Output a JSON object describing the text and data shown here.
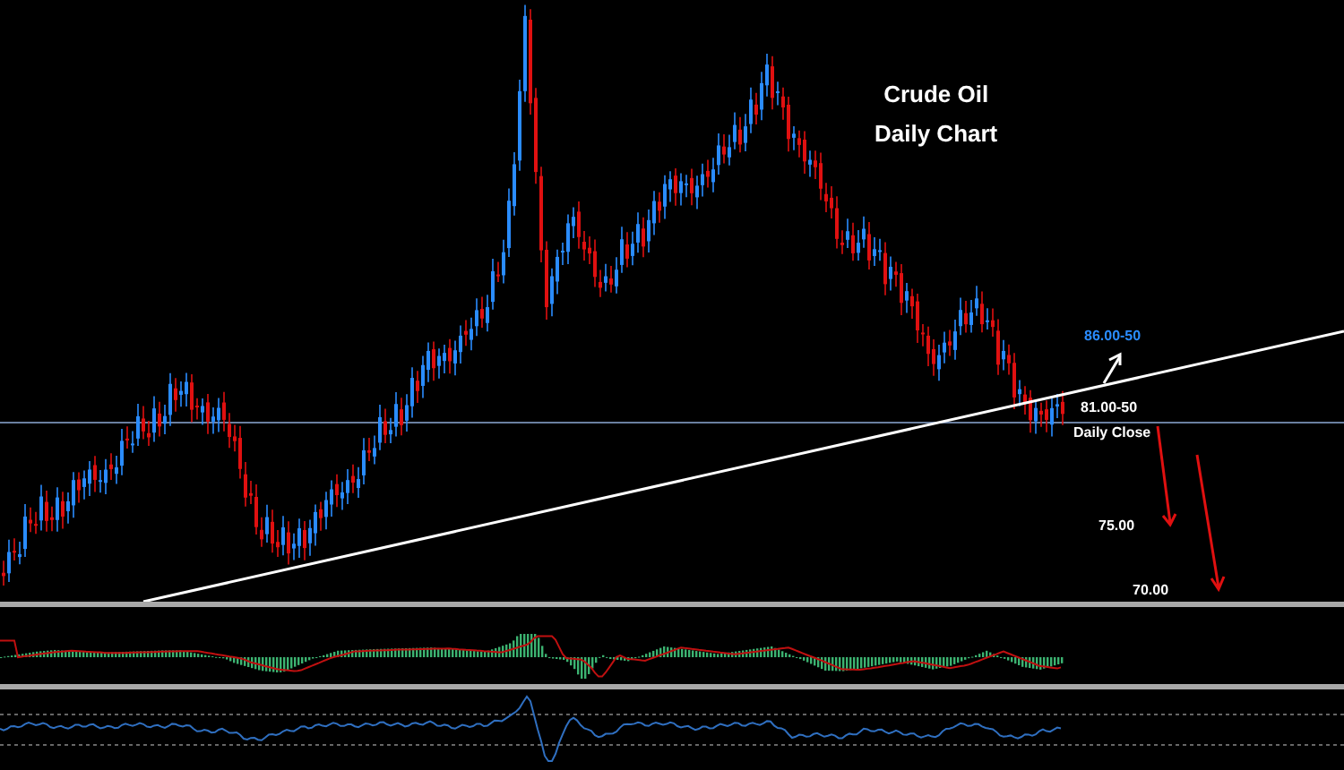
{
  "chart": {
    "title": [
      "Crude Oil",
      "Daily Chart"
    ],
    "annotations": [
      {
        "text": "86.00-50",
        "color": "#2a8cff"
      },
      {
        "text": "81.00-50",
        "color": "#ffffff"
      },
      {
        "text": "Daily Close",
        "color": "#ffffff"
      },
      {
        "text": "75.00",
        "color": "#ffffff"
      },
      {
        "text": "70.00",
        "color": "#ffffff"
      }
    ]
  }
}
